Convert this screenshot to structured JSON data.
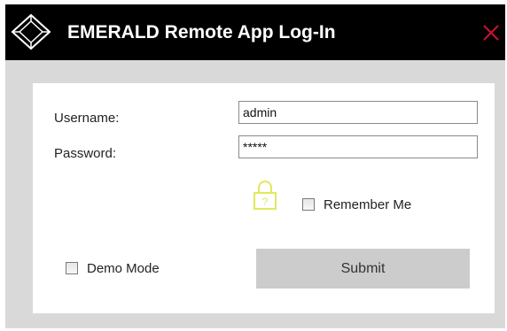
{
  "window": {
    "title": "EMERALD Remote App Log-In",
    "logo_icon": "diamond-logo-icon",
    "close_icon": "close-x-icon",
    "close_color": "#c8102e",
    "titlebar_color": "#000000"
  },
  "form": {
    "username_label": "Username:",
    "username_value": "admin",
    "password_label": "Password:",
    "password_value": "*****",
    "lock_icon": "lock-question-icon",
    "lock_color": "#e2e85a",
    "remember_label": "Remember Me",
    "remember_checked": false,
    "demo_label": "Demo Mode",
    "demo_checked": false,
    "submit_label": "Submit"
  }
}
